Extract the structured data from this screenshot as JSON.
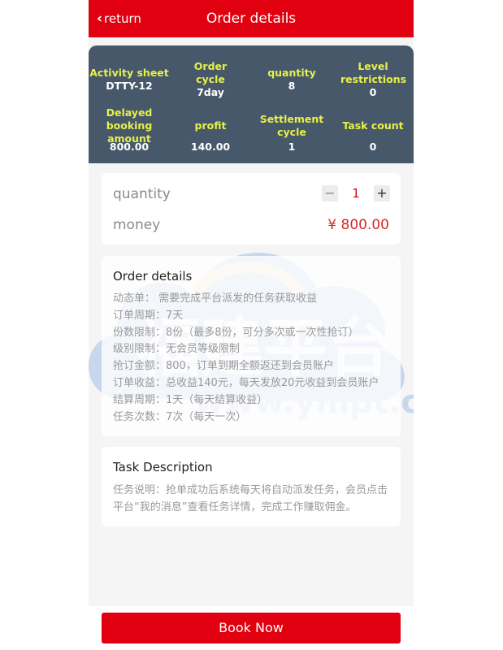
{
  "header": {
    "back_label": "return",
    "title": "Order details"
  },
  "summary": {
    "items": [
      {
        "label": "Activity sheet",
        "value": "DTTY-12"
      },
      {
        "label": "Order cycle",
        "value": "7day"
      },
      {
        "label": "quantity",
        "value": "8"
      },
      {
        "label": "Level restrictions",
        "value": "0"
      },
      {
        "label": "Delayed booking amount",
        "value": "800.00"
      },
      {
        "label": "profit",
        "value": "140.00"
      },
      {
        "label": "Settlement cycle",
        "value": "1"
      },
      {
        "label": "Task count",
        "value": "0"
      }
    ]
  },
  "order_form": {
    "quantity_label": "quantity",
    "quantity_value": "1",
    "minus_symbol": "−",
    "plus_symbol": "+",
    "money_label": "money",
    "money_value": "¥ 800.00"
  },
  "order_details": {
    "title": "Order details",
    "lines": [
      "动态单：   需要完成平台派发的任务获取收益",
      "订单周期：7天",
      "份数限制：8份（最多8份，可分多次或一次性抢订）",
      "级别限制：无会员等级限制",
      "抢订金额：800，订单到期全额返还到会员账户",
      "订单收益：总收益140元，每天发放20元收益到会员账户",
      "结算周期：1天（每天结算收益）",
      "任务次数：7次（每天一次）"
    ]
  },
  "task_description": {
    "title": "Task Description",
    "text": "任务说明：抢单成功后系统每天将自动派发任务，会员点击平台“我的消息”查看任务详情，完成工作赚取佣金。"
  },
  "watermark": {
    "text_cn": "福建平台",
    "text_en": "www.ympt.cc"
  },
  "footer": {
    "button_label": "Book Now"
  },
  "colors": {
    "brand_red": "#e0000f",
    "summary_bg": "#47586a",
    "summary_label": "#e6f04a",
    "price_red": "#d3292a"
  }
}
